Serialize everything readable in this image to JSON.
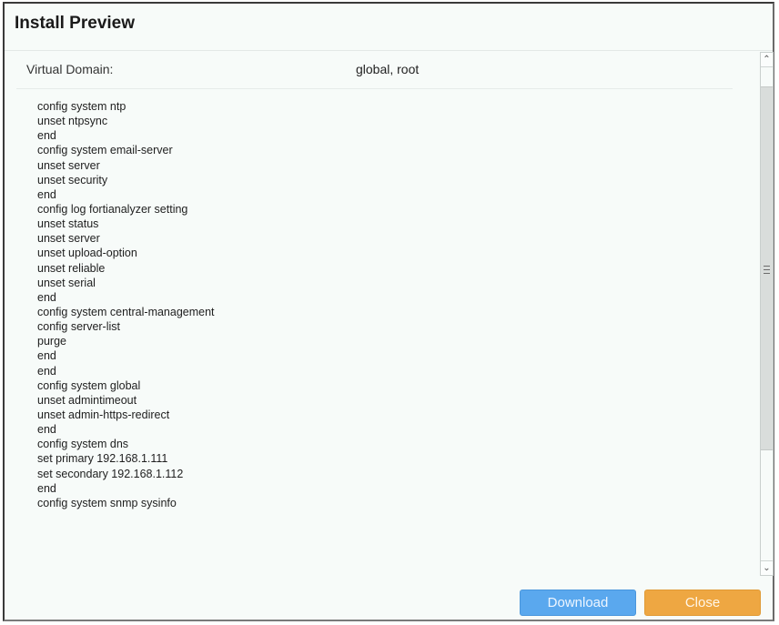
{
  "dialog": {
    "title": "Install Preview"
  },
  "virtual_domain": {
    "label": "Virtual Domain:",
    "value": "global, root"
  },
  "script_lines": [
    "config system ntp",
    "unset ntpsync",
    "end",
    "config system email-server",
    "unset server",
    "unset security",
    "end",
    "config log fortianalyzer setting",
    "unset status",
    "unset server",
    "unset upload-option",
    "unset reliable",
    "unset serial",
    "end",
    "config system central-management",
    "config server-list",
    "purge",
    "end",
    "end",
    "config system global",
    "unset admintimeout",
    "unset admin-https-redirect",
    "end",
    "config system dns",
    "set primary 192.168.1.111",
    "set secondary 192.168.1.112",
    "end",
    "config system snmp sysinfo"
  ],
  "scrollbar": {
    "up_icon": "chevron-up",
    "down_icon": "chevron-down",
    "grip_icon": "grip-lines",
    "position_fraction": 0.0,
    "visible_fraction": 0.72
  },
  "footer": {
    "download_label": "Download",
    "close_label": "Close"
  },
  "colors": {
    "download": "#5aa8ee",
    "close": "#eea742",
    "background": "#f7fbf9"
  }
}
